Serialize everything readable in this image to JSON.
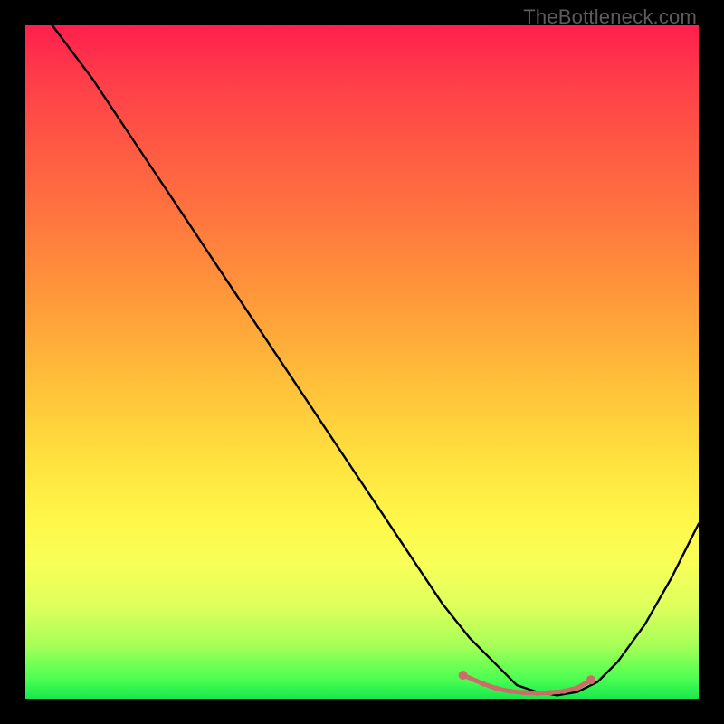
{
  "watermark": "TheBottleneck.com",
  "chart_data": {
    "type": "line",
    "title": "",
    "xlabel": "",
    "ylabel": "",
    "xlim": [
      0,
      100
    ],
    "ylim": [
      0,
      100
    ],
    "grid": false,
    "series": [
      {
        "name": "bottleneck-curve",
        "color": "#000000",
        "x": [
          4,
          10,
          16,
          22,
          28,
          34,
          40,
          46,
          52,
          58,
          62,
          66,
          70,
          73,
          76,
          79,
          82,
          85,
          88,
          92,
          96,
          100
        ],
        "y": [
          100,
          92,
          83,
          74,
          65,
          56,
          47,
          38,
          29,
          20,
          14,
          9,
          5,
          2,
          1,
          0.5,
          1,
          2.5,
          5.5,
          11,
          18,
          26
        ]
      },
      {
        "name": "optimal-range-marker",
        "color": "#cf6b68",
        "x": [
          65,
          68,
          70,
          72,
          74,
          76,
          78,
          80,
          82,
          84
        ],
        "y": [
          3.5,
          2.2,
          1.5,
          1.1,
          0.9,
          0.8,
          0.9,
          1.1,
          1.6,
          2.8
        ]
      }
    ],
    "annotations": []
  }
}
